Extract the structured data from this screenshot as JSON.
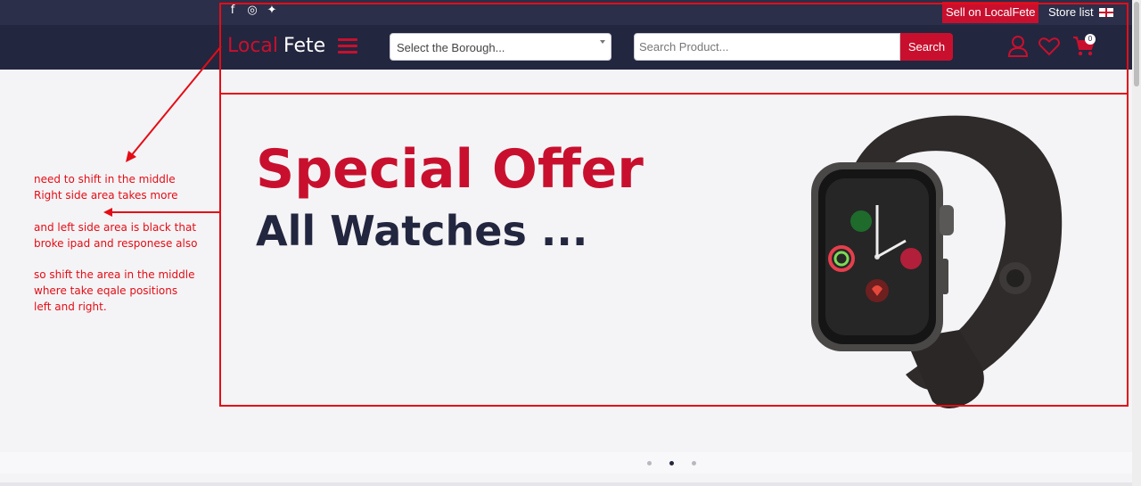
{
  "topbar": {
    "social": [
      {
        "name": "facebook-icon",
        "glyph": "f"
      },
      {
        "name": "instagram-icon",
        "glyph": "◎"
      },
      {
        "name": "twitter-icon",
        "glyph": "✦"
      }
    ],
    "sell_label": "Sell on LocalFete",
    "store_label": "Store list"
  },
  "header": {
    "logo_part1": "Local",
    "logo_part2": "Fete",
    "borough_placeholder": "Select the Borough...",
    "search_placeholder": "Search Product...",
    "search_button": "Search",
    "cart_count": "0"
  },
  "banner": {
    "title": "Special Offer",
    "subtitle": "All Watches ..."
  },
  "annotations": {
    "line1": "need to shift in the middle",
    "line2": "Right side area takes more",
    "line3": "and left side area is black that",
    "line4": "broke ipad and responese also",
    "line5": "so shift the area in the middle",
    "line6": "where take eqale positions",
    "line7": "left and right."
  },
  "carousel": {
    "active_index": 1,
    "count": 3
  },
  "colors": {
    "brand_red": "#c8102e",
    "navy": "#23263f",
    "annotation_red": "#e40d16"
  }
}
